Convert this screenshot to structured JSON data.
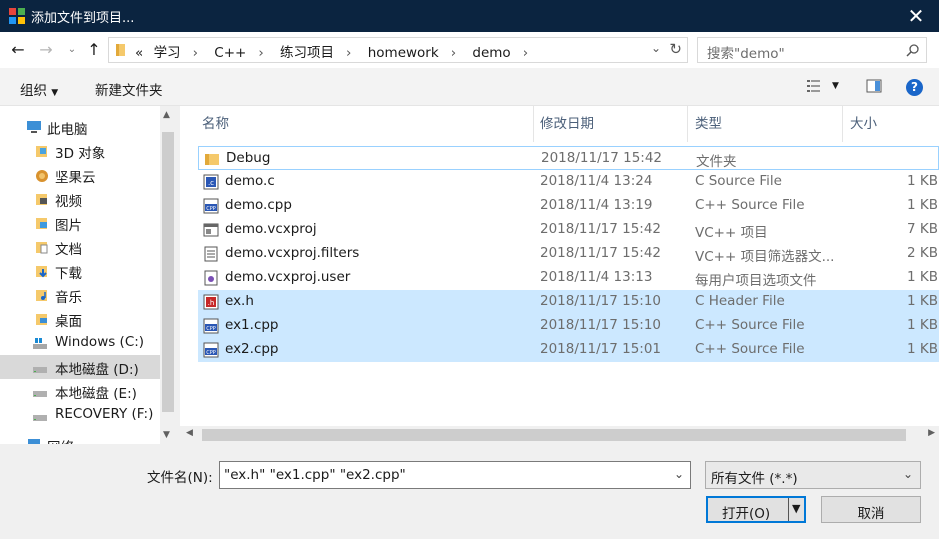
{
  "window": {
    "title": "添加文件到项目..."
  },
  "address": {
    "crumbs": [
      "«",
      "学习",
      "C++",
      "练习项目",
      "homework",
      "demo"
    ]
  },
  "search": {
    "placeholder": "搜索\"demo\""
  },
  "commands": {
    "organize": "组织",
    "new_folder": "新建文件夹"
  },
  "nav": [
    {
      "label": "此电脑",
      "icon": "pc-icon"
    },
    {
      "label": "3D 对象",
      "icon": "3d-objects-icon"
    },
    {
      "label": "坚果云",
      "icon": "nutstore-icon"
    },
    {
      "label": "视频",
      "icon": "video-folder-icon"
    },
    {
      "label": "图片",
      "icon": "pictures-folder-icon"
    },
    {
      "label": "文档",
      "icon": "documents-folder-icon"
    },
    {
      "label": "下载",
      "icon": "downloads-folder-icon"
    },
    {
      "label": "音乐",
      "icon": "music-folder-icon"
    },
    {
      "label": "桌面",
      "icon": "desktop-folder-icon"
    },
    {
      "label": "Windows (C:)",
      "icon": "windows-drive-icon"
    },
    {
      "label": "本地磁盘 (D:)",
      "icon": "drive-icon",
      "selected": true
    },
    {
      "label": "本地磁盘 (E:)",
      "icon": "drive-icon"
    },
    {
      "label": "RECOVERY (F:)",
      "icon": "drive-icon"
    },
    {
      "label": "网络",
      "icon": "network-icon"
    }
  ],
  "columns": {
    "name": "名称",
    "date": "修改日期",
    "type": "类型",
    "size": "大小"
  },
  "files": [
    {
      "name": "Debug",
      "date": "2018/11/17 15:42",
      "type": "文件夹",
      "size": "",
      "icon": "folder-icon"
    },
    {
      "name": "demo.c",
      "date": "2018/11/4 13:24",
      "type": "C Source File",
      "size": "1 KB",
      "icon": "c-file-icon"
    },
    {
      "name": "demo.cpp",
      "date": "2018/11/4 13:19",
      "type": "C++ Source File",
      "size": "1 KB",
      "icon": "cpp-file-icon"
    },
    {
      "name": "demo.vcxproj",
      "date": "2018/11/17 15:42",
      "type": "VC++ 项目",
      "size": "7 KB",
      "icon": "vcxproj-file-icon"
    },
    {
      "name": "demo.vcxproj.filters",
      "date": "2018/11/17 15:42",
      "type": "VC++ 项目筛选器文...",
      "size": "2 KB",
      "icon": "filters-file-icon"
    },
    {
      "name": "demo.vcxproj.user",
      "date": "2018/11/4 13:13",
      "type": "每用户项目选项文件",
      "size": "1 KB",
      "icon": "user-file-icon"
    },
    {
      "name": "ex.h",
      "date": "2018/11/17 15:10",
      "type": "C Header File",
      "size": "1 KB",
      "icon": "h-file-icon",
      "selected": true
    },
    {
      "name": "ex1.cpp",
      "date": "2018/11/17 15:10",
      "type": "C++ Source File",
      "size": "1 KB",
      "icon": "cpp-file-icon",
      "selected": true
    },
    {
      "name": "ex2.cpp",
      "date": "2018/11/17 15:01",
      "type": "C++ Source File",
      "size": "1 KB",
      "icon": "cpp-file-icon",
      "selected": true
    }
  ],
  "filename": {
    "label": "文件名(N):",
    "value": "\"ex.h\" \"ex1.cpp\" \"ex2.cpp\""
  },
  "filter": {
    "value": "所有文件 (*.*)"
  },
  "buttons": {
    "open": "打开(O)",
    "cancel": "取消"
  },
  "colors": {
    "titlebar": "#0b2440",
    "selection": "#cce8ff",
    "accent": "#0078d7",
    "folder": "#f5c96b"
  }
}
